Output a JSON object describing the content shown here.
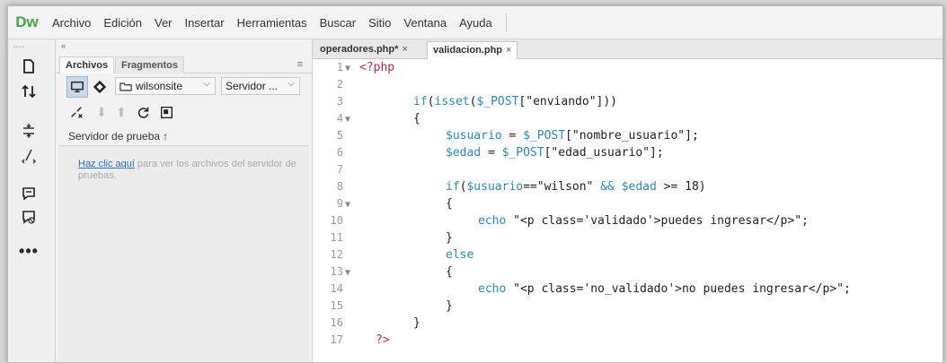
{
  "app": {
    "logo": "Dw",
    "menu": [
      "Archivo",
      "Edición",
      "Ver",
      "Insertar",
      "Herramientas",
      "Buscar",
      "Sitio",
      "Ventana",
      "Ayuda"
    ]
  },
  "files_panel": {
    "collapse_label": "«",
    "tabs": [
      "Archivos",
      "Fragmentos"
    ],
    "site_name": "wilsonsite",
    "server_option": "Servidor ...",
    "server_label": "Servidor de prueba",
    "hint_link": "Haz clic aquí",
    "hint_text": " para ver los archivos del servidor de pruebas."
  },
  "editor": {
    "tabs": [
      {
        "name": "operadores.php*",
        "close": "×"
      },
      {
        "name": "validacion.php",
        "close": "×"
      }
    ],
    "lines": [
      {
        "n": "1",
        "fold": true
      },
      {
        "n": "2",
        "fold": false
      },
      {
        "n": "3",
        "fold": false
      },
      {
        "n": "4",
        "fold": true
      },
      {
        "n": "5",
        "fold": false
      },
      {
        "n": "6",
        "fold": false
      },
      {
        "n": "7",
        "fold": false
      },
      {
        "n": "8",
        "fold": false
      },
      {
        "n": "9",
        "fold": true
      },
      {
        "n": "10",
        "fold": false
      },
      {
        "n": "11",
        "fold": false
      },
      {
        "n": "12",
        "fold": false
      },
      {
        "n": "13",
        "fold": true
      },
      {
        "n": "14",
        "fold": false
      },
      {
        "n": "15",
        "fold": false
      },
      {
        "n": "16",
        "fold": false
      },
      {
        "n": "17",
        "fold": false
      }
    ],
    "code": {
      "l1": "<?php",
      "l3_kw": "if",
      "l3_a": "(",
      "l3_fn": "isset",
      "l3_b": "(",
      "l3_var": "$_POST",
      "l3_c": "[\"enviando\"]))",
      "l4": "{",
      "l5_var": "$usuario",
      "l5_a": " = ",
      "l5_var2": "$_POST",
      "l5_b": "[\"nombre_usuario\"];",
      "l6_var": "$edad",
      "l6_a": " = ",
      "l6_var2": "$_POST",
      "l6_b": "[\"edad_usuario\"];",
      "l8_kw": "if",
      "l8_a": "(",
      "l8_var": "$usuario",
      "l8_b": "==\"wilson\" ",
      "l8_op": "&&",
      "l8_c": " ",
      "l8_var2": "$edad",
      "l8_d": " >= 18)",
      "l9": "{",
      "l10_kw": "echo",
      "l10_str": " \"<p class='validado'>puedes ingresar</p>\";",
      "l11": "}",
      "l12_kw": "else",
      "l13": "{",
      "l14_kw": "echo",
      "l14_str": " \"<p class='no_validado'>no puedes ingresar</p>\";",
      "l15": "}",
      "l16": "}",
      "l17": "?>"
    }
  }
}
